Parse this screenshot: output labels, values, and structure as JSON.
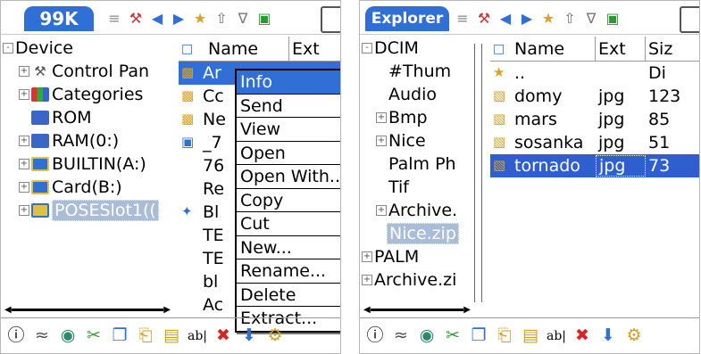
{
  "left": {
    "app_title": "99K",
    "toolbar_icons": [
      "sort-icon",
      "tool-icon",
      "back-icon",
      "forward-icon",
      "favorites-icon",
      "up-icon",
      "filter-icon",
      "card-icon"
    ],
    "tree": [
      {
        "label": "Device",
        "expand": "-",
        "icon": ""
      },
      {
        "label": "Control Pan",
        "expand": "+",
        "icon": "control-panel-icon"
      },
      {
        "label": "Categories",
        "expand": "+",
        "icon": "categories-icon"
      },
      {
        "label": "ROM",
        "expand": "",
        "icon": "rom-icon"
      },
      {
        "label": "RAM(0:)",
        "expand": "+",
        "icon": "ram-icon"
      },
      {
        "label": "BUILTIN(A:)",
        "expand": "+",
        "icon": "builtin-icon"
      },
      {
        "label": "Card(B:)",
        "expand": "+",
        "icon": "card-icon"
      },
      {
        "label": "POSESlot1((",
        "expand": "+",
        "icon": "slot-icon"
      }
    ],
    "columns": [
      "Name",
      "Ext"
    ],
    "files": [
      "Ar",
      "Cc",
      "Ne",
      "_7",
      "76",
      "Re",
      "Bl",
      "TE",
      "TE",
      "bl",
      "Ac"
    ],
    "menu": [
      "Info",
      "Send",
      "View",
      "Open",
      "Open With...",
      "Copy",
      "Cut",
      "New...",
      "Rename...",
      "Delete",
      "Extract..."
    ],
    "bottom_icons": [
      "info-icon",
      "beam-icon",
      "view-icon",
      "cut-icon",
      "copy-icon",
      "paste-icon",
      "newfolder-icon",
      "rename-icon",
      "delete-icon",
      "extract-icon",
      "more-icon"
    ]
  },
  "right": {
    "app_title": "Explorer",
    "toolbar_icons": [
      "sort-icon",
      "tool-icon",
      "back-icon",
      "forward-icon",
      "favorites-icon",
      "up-icon",
      "filter-icon",
      "card-icon"
    ],
    "tree": [
      {
        "label": "DCIM",
        "expand": "-",
        "indent": 0
      },
      {
        "label": "#Thum",
        "expand": "",
        "indent": 1
      },
      {
        "label": "Audio",
        "expand": "",
        "indent": 1
      },
      {
        "label": "Bmp",
        "expand": "+",
        "indent": 1
      },
      {
        "label": "Nice",
        "expand": "+",
        "indent": 1
      },
      {
        "label": "Palm Ph",
        "expand": "",
        "indent": 1
      },
      {
        "label": "Tif",
        "expand": "",
        "indent": 1
      },
      {
        "label": "Archive.",
        "expand": "+",
        "indent": 1
      },
      {
        "label": "Nice.zip",
        "expand": "",
        "indent": 1
      },
      {
        "label": "PALM",
        "expand": "+",
        "indent": 0
      },
      {
        "label": "Archive.zi",
        "expand": "+",
        "indent": 0
      }
    ],
    "columns": [
      "Name",
      "Ext",
      "Siz"
    ],
    "files": [
      {
        "name": "..",
        "ext": "",
        "size": "Di",
        "icon": "parent-folder-icon"
      },
      {
        "name": "domy",
        "ext": "jpg",
        "size": "123",
        "icon": "image-file-icon"
      },
      {
        "name": "mars",
        "ext": "jpg",
        "size": "85",
        "icon": "image-file-icon"
      },
      {
        "name": "sosanka",
        "ext": "jpg",
        "size": "51",
        "icon": "image-file-icon"
      },
      {
        "name": "tornado",
        "ext": "jpg",
        "size": "73",
        "icon": "image-file-icon"
      }
    ],
    "bottom_icons": [
      "info-icon",
      "beam-icon",
      "view-icon",
      "cut-icon",
      "copy-icon",
      "paste-icon",
      "newfolder-icon",
      "rename-icon",
      "delete-icon",
      "extract-icon",
      "more-icon"
    ]
  }
}
